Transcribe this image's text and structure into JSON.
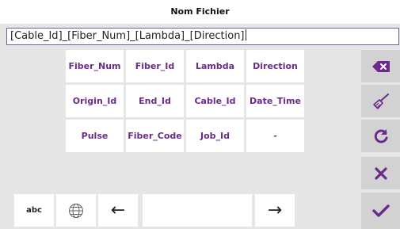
{
  "header": {
    "title": "Nom Fichier"
  },
  "filename_field": {
    "value": "[Cable_Id]_[Fiber_Num]_[Lambda]_[Direction]"
  },
  "tokens": {
    "row1": [
      "Fiber_Num",
      "Fiber_Id",
      "Lambda",
      "Direction"
    ],
    "row2": [
      "Origin_Id",
      "End_Id",
      "Cable_Id",
      "Date_Time"
    ],
    "row3": [
      "Pulse",
      "Fiber_Code",
      "Job_Id",
      "-"
    ]
  },
  "side_actions": {
    "icons": [
      "backspace-icon",
      "clear-broom-icon",
      "refresh-icon",
      "close-icon",
      "confirm-check-icon"
    ]
  },
  "bottom_bar": {
    "abc_label": "abc",
    "globe_icon": "globe-icon",
    "left_arrow": "←",
    "right_arrow": "→"
  },
  "colors": {
    "accent": "#6b2a8c",
    "background": "#e6e6e6",
    "key": "#ffffff",
    "side": "#d2d2d2"
  }
}
